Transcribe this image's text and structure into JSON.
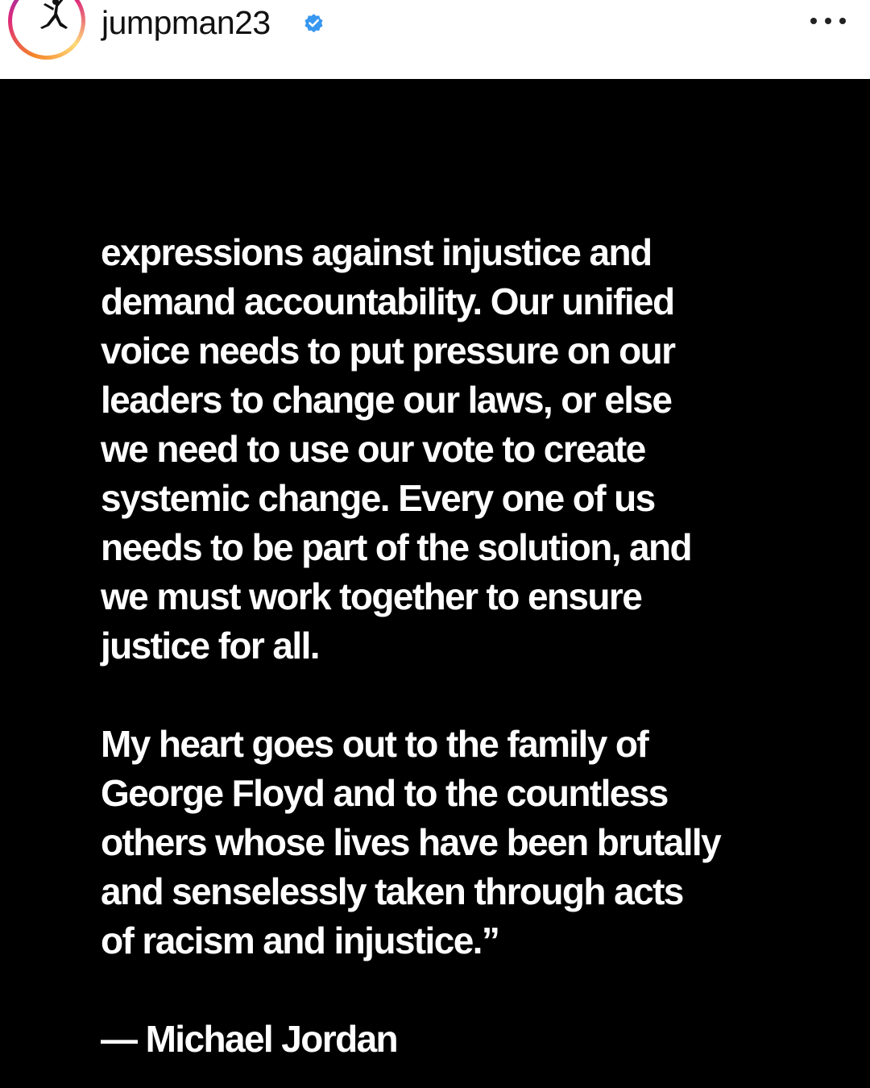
{
  "header": {
    "username": "jumpman23",
    "verified_icon": "verified-badge-icon",
    "verified_color": "#3897f0",
    "menu_icon": "more-options-icon",
    "avatar_icon": "jumpman-logo-icon"
  },
  "post": {
    "background": "#000000",
    "text_color": "#ffffff",
    "paragraph_1": [
      "expressions against injustice and",
      "demand accountability. Our unified",
      "voice needs to put pressure on our",
      "leaders to change our laws, or else",
      "we need to use our vote to create",
      "systemic change. Every one of us",
      "needs to be part of the solution, and",
      "we must work together to ensure",
      "justice for all."
    ],
    "paragraph_2": [
      "My heart goes out to the family of",
      "George Floyd and to the countless",
      "others whose lives have been brutally",
      "and senselessly taken through acts",
      "of racism and injustice.”"
    ],
    "attribution": "— Michael Jordan"
  }
}
